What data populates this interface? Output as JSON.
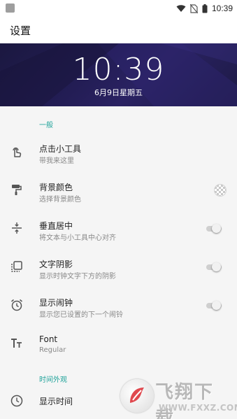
{
  "status_bar": {
    "time": "10:39",
    "icons": [
      "notification-icon",
      "wifi-icon",
      "no-sim-icon",
      "battery-icon"
    ]
  },
  "app_bar": {
    "title": "设置"
  },
  "preview": {
    "time": "10:39",
    "date": "6月9日星期五",
    "background_color": "#231d55"
  },
  "colors": {
    "accent": "#20a39a",
    "list_background": "#f5f5f5"
  },
  "sections": {
    "general": "一般",
    "time_appearance": "时间外观"
  },
  "items": [
    {
      "icon": "touch-icon",
      "title": "点击小工具",
      "subtitle": "带我来这里"
    },
    {
      "icon": "paint-roller-icon",
      "title": "背景颜色",
      "subtitle": "选择背景颜色",
      "control": "color-swatch"
    },
    {
      "icon": "vertical-center-icon",
      "title": "垂直居中",
      "subtitle": "将文本与小工具中心对齐",
      "control": "toggle",
      "checked": false
    },
    {
      "icon": "text-shadow-icon",
      "title": "文字阴影",
      "subtitle": "显示时钟文字下方的阴影",
      "control": "toggle",
      "checked": false
    },
    {
      "icon": "alarm-icon",
      "title": "显示闹钟",
      "subtitle": "显示您已设置的下一个闹铃",
      "control": "toggle",
      "checked": false
    },
    {
      "icon": "font-icon",
      "title": "Font",
      "subtitle": "Regular"
    },
    {
      "icon": "clock-icon",
      "title": "显示时间",
      "subtitle": ""
    }
  ],
  "watermark": {
    "text": "飞翔下载",
    "url": "WWW.FXXZ.COM"
  }
}
